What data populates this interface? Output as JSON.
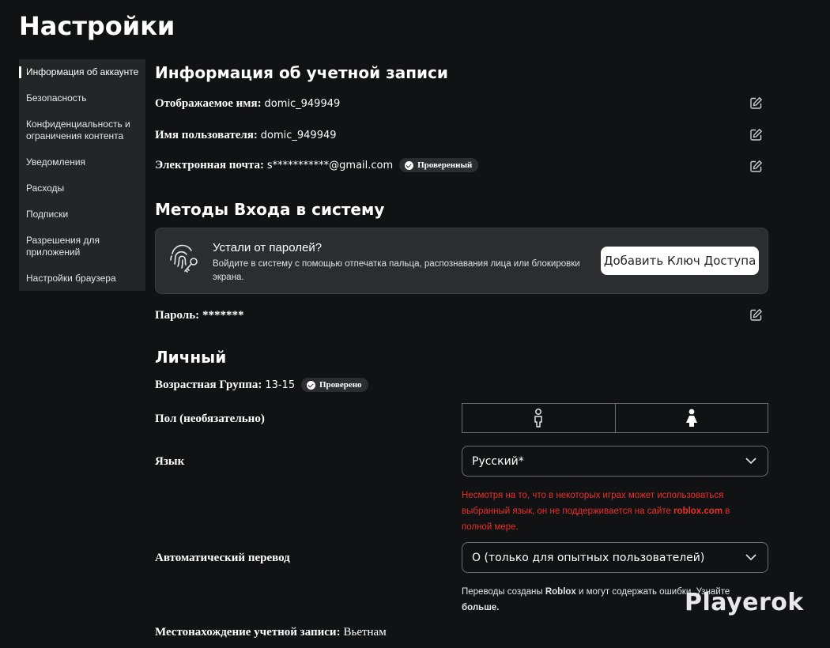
{
  "page_title": "Настройки",
  "sidebar": {
    "items": [
      {
        "label": "Информация об аккаунте"
      },
      {
        "label": "Безопасность"
      },
      {
        "label": "Конфиденциальность и ограничения контента"
      },
      {
        "label": "Уведомления"
      },
      {
        "label": "Расходы"
      },
      {
        "label": "Подписки"
      },
      {
        "label": "Разрешения для приложений"
      },
      {
        "label": "Настройки браузера"
      }
    ]
  },
  "account_info": {
    "title": "Информация об учетной записи",
    "display_name_label": "Отображаемое имя:",
    "display_name_value": "domic_949949",
    "username_label": "Имя пользователя:",
    "username_value": "domic_949949",
    "email_label": "Электронная почта:",
    "email_value": "s***********@gmail.com",
    "email_badge": "Проверенный"
  },
  "login_methods": {
    "title": "Методы Входа в систему",
    "passkey_title": "Устали от паролей?",
    "passkey_desc": "Войдите в систему с помощью отпечатка пальца, распознавания лица или блокировки экрана.",
    "passkey_button": "Добавить Ключ Доступа",
    "password_label": "Пароль:",
    "password_value": "*******"
  },
  "personal": {
    "title": "Личный",
    "age_label": "Возрастная Группа:",
    "age_value": "13-15",
    "age_badge": "Проверено",
    "gender_label": "Пол (необязательно)",
    "language_label": "Язык",
    "language_value": "Русский*",
    "language_warning_1": "Несмотря на то, что в некоторых играх может использоваться выбранный язык, он не поддерживается на сайте ",
    "language_warning_site": "roblox.com",
    "language_warning_2": " в полной мере.",
    "autotranslate_label": "Автоматический перевод",
    "autotranslate_value": "О (только для опытных пользователей)",
    "autotranslate_info_1": "Переводы созданы ",
    "autotranslate_info_brand": "Roblox",
    "autotranslate_info_2": " и могут содержать ошибки. Узнайте ",
    "autotranslate_info_link": "больше.",
    "location_label": "Местонахождение учетной записи:",
    "location_value": "Вьетнам"
  },
  "watermark": "Playerok"
}
